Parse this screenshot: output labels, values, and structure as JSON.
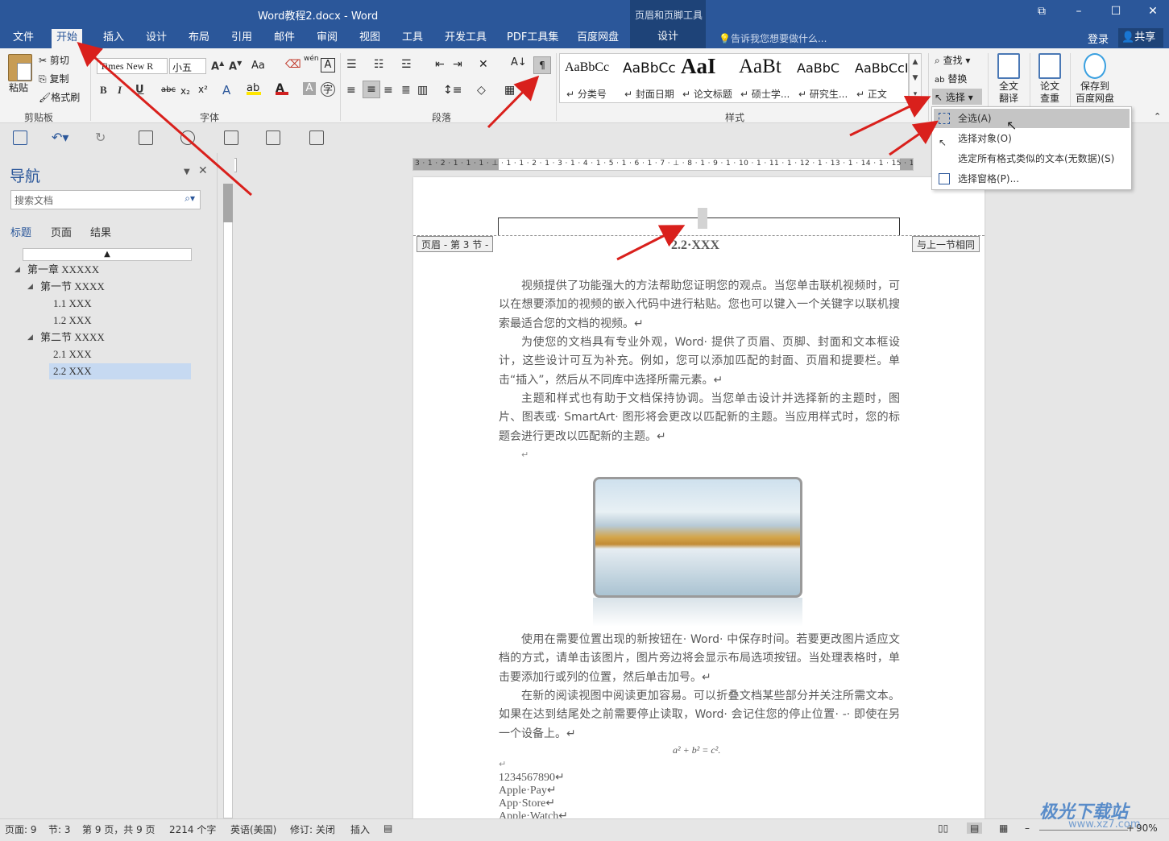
{
  "window": {
    "title": "Word教程2.docx - Word",
    "context_tab_group": "页眉和页脚工具"
  },
  "tabs": [
    "文件",
    "开始",
    "插入",
    "设计",
    "布局",
    "引用",
    "邮件",
    "审阅",
    "视图",
    "工具",
    "开发工具",
    "PDF工具集",
    "百度网盘",
    "设计"
  ],
  "tell_me": "告诉我您想要做什么...",
  "login": "登录",
  "share": "共享",
  "ribbon": {
    "clipboard": {
      "paste": "粘贴",
      "cut": "剪切",
      "copy": "复制",
      "format_painter": "格式刷",
      "group": "剪贴板"
    },
    "font": {
      "name": "Times New R",
      "size": "小五",
      "group": "字体",
      "wen": "wén",
      "aa": "Aa"
    },
    "paragraph": {
      "group": "段落"
    },
    "styles": {
      "group": "样式",
      "items": [
        {
          "sample": "AaBbCc",
          "name": "↵ 分类号"
        },
        {
          "sample": "AaBbCc",
          "name": "↵ 封面日期"
        },
        {
          "sample": "AaI",
          "name": "↵ 论文标题"
        },
        {
          "sample": "AaBt",
          "name": "↵ 硕士学..."
        },
        {
          "sample": "AaBbC",
          "name": "↵ 研究生..."
        },
        {
          "sample": "AaBbCcI",
          "name": "↵ 正文"
        }
      ]
    },
    "editing": {
      "find": "查找",
      "replace": "替换",
      "select": "选择"
    },
    "translate": "全文\n翻译",
    "check": "论文\n查重",
    "baidu": "保存到\n百度网盘"
  },
  "nav": {
    "title": "导航",
    "search_placeholder": "搜索文档",
    "tabs": [
      "标题",
      "页面",
      "结果"
    ],
    "tree": [
      {
        "label": "第一章 XXXXX"
      },
      {
        "label": "第一节 XXXX"
      },
      {
        "label": "1.1 XXX"
      },
      {
        "label": "1.2 XXX"
      },
      {
        "label": "第二节 XXXX"
      },
      {
        "label": "2.1 XXX"
      },
      {
        "label": "2.2 XXX"
      }
    ]
  },
  "ruler": {
    "numbers": "3 · 1 · 2 · 1 · 1 · 1 · ⊥ · 1 · 1 · 2 · 1 · 3 · 1 · 4 · 1 · 5 · 1 · 6 · 1 · 7 · ⊥ · 8 · 1 · 9 · 1 · 10 · 1 · 11 · 1 · 12 · 1 · 13 · 1 · 14 · 1 · 15 · 1"
  },
  "document": {
    "header_left_tag": "页眉 - 第 3 节 -",
    "header_right_tag": "与上一节相同",
    "heading": "2.2·XXX",
    "paragraphs": [
      "视频提供了功能强大的方法帮助您证明您的观点。当您单击联机视频时，可以在想要添加的视频的嵌入代码中进行粘贴。您也可以键入一个关键字以联机搜索最适合您的文档的视频。↵",
      "为使您的文档具有专业外观，Word· 提供了页眉、页脚、封面和文本框设计，这些设计可互为补充。例如，您可以添加匹配的封面、页眉和提要栏。单击“插入”，然后从不同库中选择所需元素。↵",
      "主题和样式也有助于文档保持协调。当您单击设计并选择新的主题时，图片、图表或· SmartArt· 图形将会更改以匹配新的主题。当应用样式时，您的标题会进行更改以匹配新的主题。↵",
      "使用在需要位置出现的新按钮在· Word· 中保存时间。若要更改图片适应文档的方式，请单击该图片，图片旁边将会显示布局选项按钮。当处理表格时，单击要添加行或列的位置，然后单击加号。↵",
      "在新的阅读视图中阅读更加容易。可以折叠文档某些部分并关注所需文本。如果在达到结尾处之前需要停止读取，Word· 会记住您的停止位置· -· 即使在另一个设备上。↵"
    ],
    "equation": "a² + b² = c².",
    "lines": [
      "1234567890↵",
      "Apple·Pay↵",
      "App·Store↵",
      "Apple·Watch↵"
    ]
  },
  "dropdown": {
    "items": [
      "全选(A)",
      "选择对象(O)",
      "选定所有格式类似的文本(无数据)(S)",
      "选择窗格(P)..."
    ]
  },
  "status": {
    "page": "页面: 9",
    "section": "节: 3",
    "pages": "第 9 页，共 9 页",
    "words": "2214 个字",
    "lang": "英语(美国)",
    "revision": "修订: 关闭",
    "insert": "插入",
    "zoom": "90%"
  },
  "watermark": {
    "brand": "极光下载站",
    "url": "www.xz7.com"
  }
}
